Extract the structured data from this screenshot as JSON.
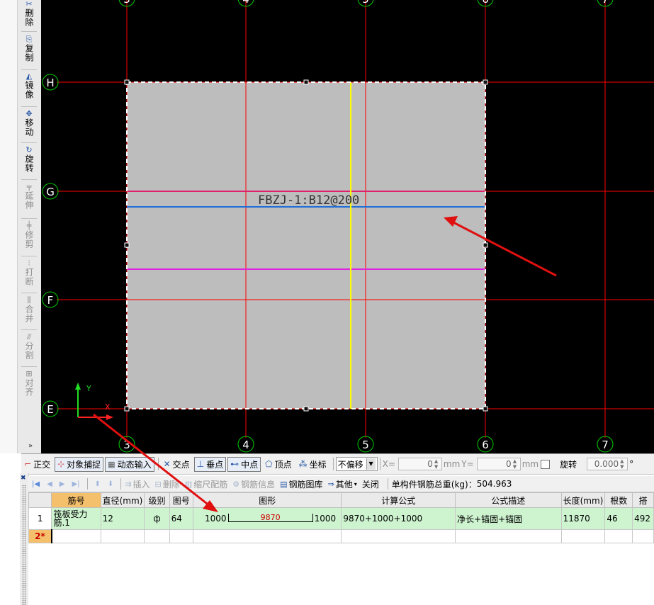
{
  "left_toolbar": {
    "items": [
      {
        "icon": "delete-icon",
        "glyph": "✂",
        "label": "删除",
        "enabled": true
      },
      {
        "icon": "copy-icon",
        "glyph": "⎘",
        "label": "复制",
        "enabled": true
      },
      {
        "icon": "mirror-icon",
        "glyph": "◭",
        "label": "镜像",
        "enabled": true
      },
      {
        "icon": "move-icon",
        "glyph": "✥",
        "label": "移动",
        "enabled": true
      },
      {
        "icon": "rotate-icon",
        "glyph": "↻",
        "label": "旋转",
        "enabled": true
      },
      {
        "icon": "extend-icon",
        "glyph": "╤",
        "label": "延伸",
        "enabled": false
      },
      {
        "icon": "trim-icon",
        "glyph": "╪",
        "label": "修剪",
        "enabled": false
      },
      {
        "icon": "break-icon",
        "glyph": "⫶",
        "label": "打断",
        "enabled": false
      },
      {
        "icon": "merge-icon",
        "glyph": "⫼",
        "label": "合并",
        "enabled": false
      },
      {
        "icon": "split-icon",
        "glyph": "⫻",
        "label": "分割",
        "enabled": false
      },
      {
        "icon": "align-icon",
        "glyph": "⊞",
        "label": "对齐",
        "enabled": false
      }
    ],
    "more": "»"
  },
  "canvas": {
    "vertical_axes": [
      "3",
      "4",
      "5",
      "6",
      "7"
    ],
    "horizontal_axes": [
      "H",
      "G",
      "F",
      "E"
    ],
    "slab_label": "FBZJ-1:B12@200",
    "ucs_x": "X",
    "ucs_y": "Y",
    "colors": {
      "background": "#000000",
      "grid": "#ff0000",
      "axis_bubble": "#00cc00",
      "slab": "#bdbdbd",
      "rebar_top": "#e0206a",
      "rebar_blue": "#1e6fd8",
      "rebar_magenta": "#e020e0",
      "rebar_yellow": "#ffff00",
      "arrow": "#e01010"
    }
  },
  "snap_toolbar": {
    "ortho": "正交",
    "object_snap": "对象捕捉",
    "dynamic_input": "动态输入",
    "intersection": "交点",
    "perpendicular": "垂点",
    "midpoint": "中点",
    "vertex": "顶点",
    "coordinate": "坐标",
    "offset_mode": "不偏移",
    "x_label": "X=",
    "x_value": "0",
    "x_unit": "mm",
    "y_label": "Y=",
    "y_value": "0",
    "y_unit": "mm",
    "rotate_label": "旋转",
    "rotate_value": "0.000",
    "degree": "°"
  },
  "rebar_toolbar": {
    "insert": "插入",
    "delete": "删除",
    "scale_rebar": "缩尺配筋",
    "rebar_info": "钢筋信息",
    "rebar_library": "钢筋图库",
    "other": "其他",
    "close": "关闭",
    "total_weight_label": "单构件钢筋总重(kg)：",
    "total_weight": "504.963"
  },
  "rebar_table": {
    "columns": [
      "",
      "筋号",
      "直径(mm)",
      "级别",
      "图号",
      "图形",
      "计算公式",
      "公式描述",
      "长度(mm)",
      "根数",
      "搭"
    ],
    "rows": [
      {
        "num": "1",
        "name": "筏板受力筋.1",
        "diameter": "12",
        "grade": "ф",
        "shape_no": "64",
        "shape_left": "1000",
        "shape_mid": "9870",
        "shape_right": "1000",
        "formula": "9870+1000+1000",
        "description": "净长+锚固+锚固",
        "length": "11870",
        "count": "46",
        "lap": "492"
      }
    ],
    "new_row_label": "2*"
  }
}
